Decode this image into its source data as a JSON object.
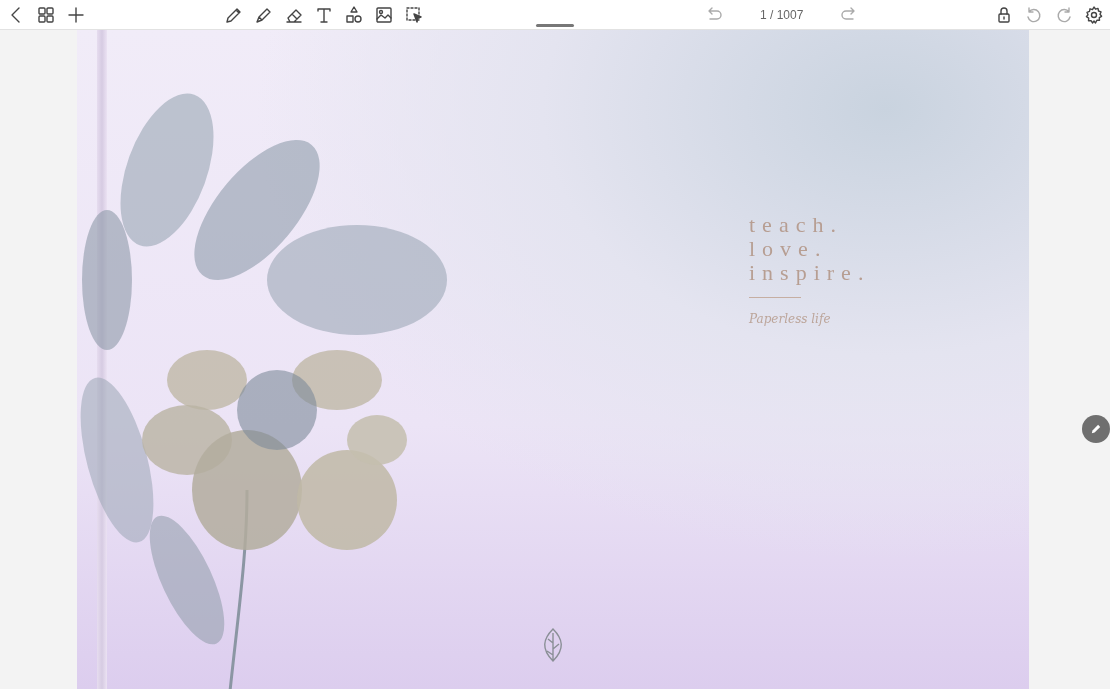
{
  "toolbar": {
    "page_indicator": "1 / 1007"
  },
  "cover": {
    "motto_lines": [
      "teach.",
      "love.",
      "inspire."
    ],
    "signature": "Paperless life"
  }
}
